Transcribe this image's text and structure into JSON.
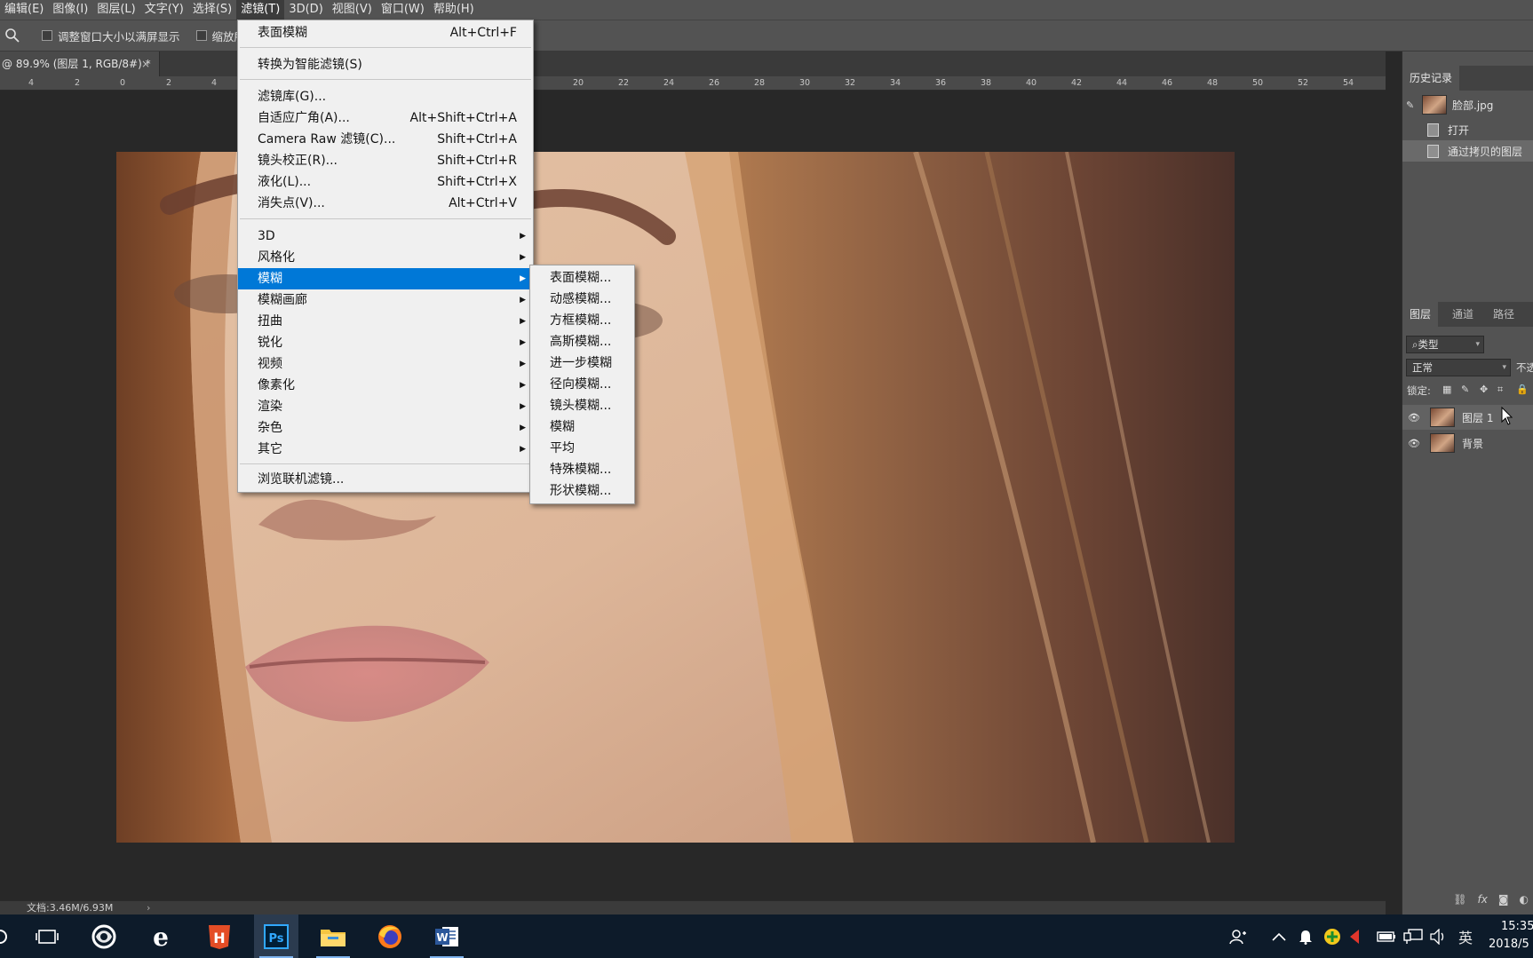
{
  "menubar": {
    "items": [
      "编辑(E)",
      "图像(I)",
      "图层(L)",
      "文字(Y)",
      "选择(S)",
      "滤镜(T)",
      "3D(D)",
      "视图(V)",
      "窗口(W)",
      "帮助(H)"
    ],
    "active": "滤镜(T)"
  },
  "options": {
    "resize_windows": "调整窗口大小以满屏显示",
    "zoom_all": "缩放所"
  },
  "document": {
    "tab_title": "@ 89.9% (图层 1, RGB/8#) *",
    "close": "×",
    "status": "文档:3.46M/6.93M",
    "status_arrow": "›"
  },
  "ruler": {
    "ticks": [
      "4",
      "2",
      "0",
      "2",
      "4",
      "20",
      "22",
      "24",
      "26",
      "28",
      "30",
      "32",
      "34",
      "36",
      "38",
      "40",
      "42",
      "44",
      "46",
      "48",
      "50",
      "52",
      "54"
    ]
  },
  "filter_menu": {
    "items": [
      {
        "label": "表面模糊",
        "shortcut": "Alt+Ctrl+F"
      },
      {
        "label": "转换为智能滤镜(S)",
        "shortcut": ""
      },
      {
        "label": "滤镜库(G)...",
        "shortcut": ""
      },
      {
        "label": "自适应广角(A)...",
        "shortcut": "Alt+Shift+Ctrl+A"
      },
      {
        "label": "Camera Raw 滤镜(C)...",
        "shortcut": "Shift+Ctrl+A"
      },
      {
        "label": "镜头校正(R)...",
        "shortcut": "Shift+Ctrl+R"
      },
      {
        "label": "液化(L)...",
        "shortcut": "Shift+Ctrl+X"
      },
      {
        "label": "消失点(V)...",
        "shortcut": "Alt+Ctrl+V"
      },
      {
        "label": "3D",
        "submenu": true
      },
      {
        "label": "风格化",
        "submenu": true
      },
      {
        "label": "模糊",
        "submenu": true,
        "highlighted": true
      },
      {
        "label": "模糊画廊",
        "submenu": true
      },
      {
        "label": "扭曲",
        "submenu": true
      },
      {
        "label": "锐化",
        "submenu": true
      },
      {
        "label": "视频",
        "submenu": true
      },
      {
        "label": "像素化",
        "submenu": true
      },
      {
        "label": "渲染",
        "submenu": true
      },
      {
        "label": "杂色",
        "submenu": true
      },
      {
        "label": "其它",
        "submenu": true
      },
      {
        "label": "浏览联机滤镜...",
        "shortcut": ""
      }
    ]
  },
  "blur_submenu": {
    "items": [
      "表面模糊...",
      "动感模糊...",
      "方框模糊...",
      "高斯模糊...",
      "进一步模糊",
      "径向模糊...",
      "镜头模糊...",
      "模糊",
      "平均",
      "特殊模糊...",
      "形状模糊..."
    ]
  },
  "history_panel": {
    "tab": "历史记录",
    "snapshot": "脸部.jpg",
    "entries": [
      "打开",
      "通过拷贝的图层"
    ]
  },
  "layers_panel": {
    "tabs": [
      "图层",
      "通道",
      "路径"
    ],
    "filter_kind": "类型",
    "blend_mode": "正常",
    "opacity_label": "不透",
    "lock_label": "锁定:",
    "layers": [
      "图层 1",
      "背景"
    ]
  },
  "taskbar": {
    "ime": "英",
    "time": "15:35",
    "date": "2018/5",
    "apps": [
      "task-view",
      "baidu-netdisk",
      "internet-explorer",
      "html-builder",
      "photoshop",
      "file-explorer",
      "firefox",
      "word"
    ]
  },
  "colors": {
    "menu_highlight": "#0078d7",
    "ps_blue": "#31a8ff",
    "taskbar": "#0d1b2a"
  }
}
